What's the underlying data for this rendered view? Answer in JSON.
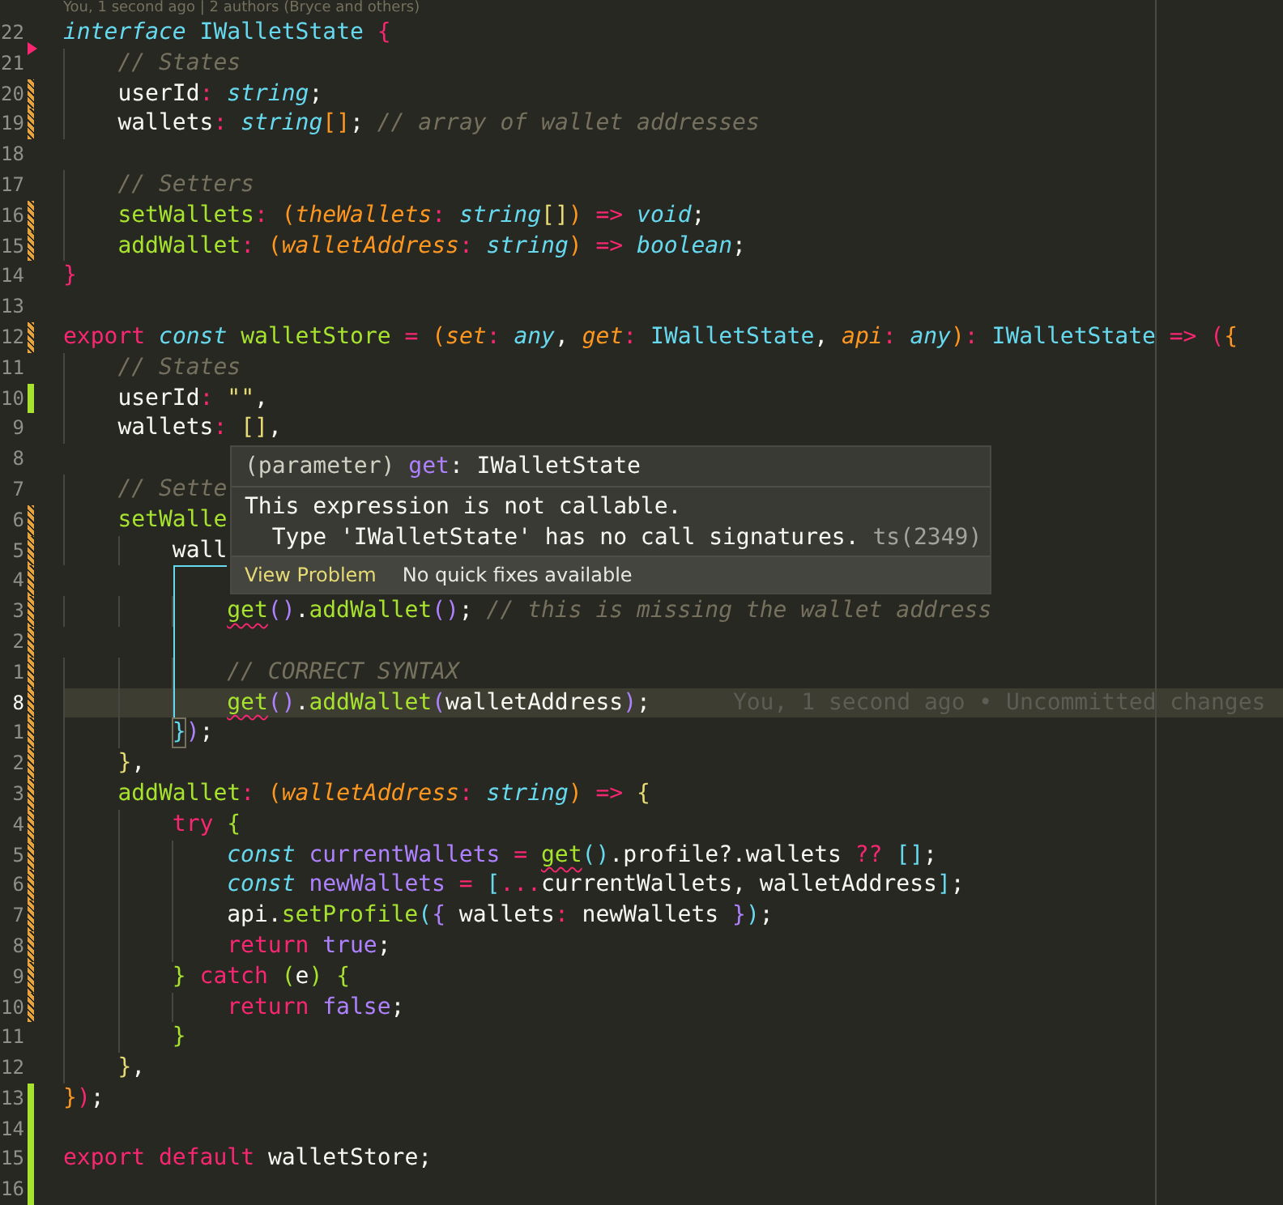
{
  "codelens": "You, 1 second ago | 2 authors (Bryce and others)",
  "lines": [
    {
      "number": "22",
      "kind": "unchanged",
      "current": false,
      "tokens": [
        {
          "t": "interface ",
          "kind": "st"
        },
        {
          "t": "IWalletState ",
          "kind": "ty"
        },
        {
          "t": "{",
          "kind": "bp"
        }
      ]
    },
    {
      "number": "21",
      "kind": "deleted",
      "current": false,
      "tokens": [
        {
          "t": "    // States",
          "kind": "cm"
        }
      ]
    },
    {
      "number": "20",
      "kind": "modified",
      "current": false,
      "tokens": [
        {
          "t": "    userId",
          "kind": "tx"
        },
        {
          "t": ": ",
          "kind": "pu"
        },
        {
          "t": "string",
          "kind": "ti"
        },
        {
          "t": ";",
          "kind": "tx"
        }
      ]
    },
    {
      "number": "19",
      "kind": "modified",
      "current": false,
      "tokens": [
        {
          "t": "    wallets",
          "kind": "tx"
        },
        {
          "t": ": ",
          "kind": "pu"
        },
        {
          "t": "string",
          "kind": "ti"
        },
        {
          "t": "[]",
          "kind": "bo"
        },
        {
          "t": "; ",
          "kind": "tx"
        },
        {
          "t": "// array of wallet addresses",
          "kind": "cm"
        }
      ]
    },
    {
      "number": "18",
      "kind": "unchanged",
      "current": false
    },
    {
      "number": "17",
      "kind": "unchanged",
      "current": false,
      "tokens": [
        {
          "t": "    // Setters",
          "kind": "cm"
        }
      ]
    },
    {
      "number": "16",
      "kind": "modified",
      "current": false,
      "tokens": [
        {
          "t": "    setWallets",
          "kind": "fn"
        },
        {
          "t": ": ",
          "kind": "pu"
        },
        {
          "t": "(",
          "kind": "bo"
        },
        {
          "t": "theWallets",
          "kind": "pa"
        },
        {
          "t": ": ",
          "kind": "pu"
        },
        {
          "t": "string",
          "kind": "ti"
        },
        {
          "t": "[]",
          "kind": "by"
        },
        {
          "t": ") ",
          "kind": "bo"
        },
        {
          "t": "=> ",
          "kind": "op"
        },
        {
          "t": "void",
          "kind": "ti"
        },
        {
          "t": ";",
          "kind": "tx"
        }
      ]
    },
    {
      "number": "15",
      "kind": "modified",
      "current": false,
      "tokens": [
        {
          "t": "    addWallet",
          "kind": "fn"
        },
        {
          "t": ": ",
          "kind": "pu"
        },
        {
          "t": "(",
          "kind": "bo"
        },
        {
          "t": "walletAddress",
          "kind": "pa"
        },
        {
          "t": ": ",
          "kind": "pu"
        },
        {
          "t": "string",
          "kind": "ti"
        },
        {
          "t": ") ",
          "kind": "bo"
        },
        {
          "t": "=> ",
          "kind": "op"
        },
        {
          "t": "boolean",
          "kind": "ti"
        },
        {
          "t": ";",
          "kind": "tx"
        }
      ]
    },
    {
      "number": "14",
      "kind": "unchanged",
      "current": false,
      "tokens": [
        {
          "t": "}",
          "kind": "bp"
        }
      ]
    },
    {
      "number": "13",
      "kind": "unchanged",
      "current": false
    },
    {
      "number": "12",
      "kind": "modified",
      "current": false,
      "tokens": [
        {
          "t": "export ",
          "kind": "kw"
        },
        {
          "t": "const ",
          "kind": "st"
        },
        {
          "t": "walletStore ",
          "kind": "fn"
        },
        {
          "t": "= ",
          "kind": "op"
        },
        {
          "t": "(",
          "kind": "bo"
        },
        {
          "t": "set",
          "kind": "pa"
        },
        {
          "t": ": ",
          "kind": "pu"
        },
        {
          "t": "any",
          "kind": "ti"
        },
        {
          "t": ", ",
          "kind": "tx"
        },
        {
          "t": "get",
          "kind": "pa"
        },
        {
          "t": ": ",
          "kind": "pu"
        },
        {
          "t": "IWalletState",
          "kind": "ty"
        },
        {
          "t": ", ",
          "kind": "tx"
        },
        {
          "t": "api",
          "kind": "pa"
        },
        {
          "t": ": ",
          "kind": "pu"
        },
        {
          "t": "any",
          "kind": "ti"
        },
        {
          "t": ")",
          "kind": "bo"
        },
        {
          "t": ": ",
          "kind": "pu"
        },
        {
          "t": "IWalletState ",
          "kind": "ty"
        },
        {
          "t": "=> ",
          "kind": "op"
        },
        {
          "t": "(",
          "kind": "bp"
        },
        {
          "t": "{",
          "kind": "bo"
        }
      ]
    },
    {
      "number": "11",
      "kind": "unchanged",
      "current": false,
      "tokens": [
        {
          "t": "    // States",
          "kind": "cm"
        }
      ]
    },
    {
      "number": "10",
      "kind": "added",
      "current": false,
      "tokens": [
        {
          "t": "    userId",
          "kind": "tx"
        },
        {
          "t": ": ",
          "kind": "pu"
        },
        {
          "t": "\"\"",
          "kind": "s"
        },
        {
          "t": ",",
          "kind": "tx"
        }
      ]
    },
    {
      "number": "9",
      "kind": "unchanged",
      "current": false,
      "tokens": [
        {
          "t": "    wallets",
          "kind": "tx"
        },
        {
          "t": ": ",
          "kind": "pu"
        },
        {
          "t": "[]",
          "kind": "by"
        },
        {
          "t": ",",
          "kind": "tx"
        }
      ]
    },
    {
      "number": "8",
      "kind": "unchanged",
      "current": false
    },
    {
      "number": "7",
      "kind": "unchanged",
      "current": false,
      "tokens": [
        {
          "t": "    // Sette",
          "kind": "cm"
        }
      ]
    },
    {
      "number": "6",
      "kind": "modified",
      "current": false,
      "tokens": [
        {
          "t": "    setWalle",
          "kind": "fn"
        }
      ]
    },
    {
      "number": "5",
      "kind": "modified",
      "current": false,
      "tokens": [
        {
          "t": "        wall",
          "kind": "tx"
        }
      ]
    },
    {
      "number": "4",
      "kind": "modified",
      "current": false
    },
    {
      "number": "3",
      "kind": "modified",
      "current": false,
      "tokens": [
        {
          "t": "            get",
          "kind": "err"
        },
        {
          "t": "()",
          "kind": "bv"
        },
        {
          "t": ".",
          "kind": "tx"
        },
        {
          "t": "addWallet",
          "kind": "fn"
        },
        {
          "t": "()",
          "kind": "bv"
        },
        {
          "t": "; ",
          "kind": "tx"
        },
        {
          "t": "// this is missing the wallet address",
          "kind": "cm"
        }
      ]
    },
    {
      "number": "2",
      "kind": "modified",
      "current": false
    },
    {
      "number": "1",
      "kind": "modified",
      "current": false,
      "tokens": [
        {
          "t": "            // CORRECT SYNTAX",
          "kind": "cm"
        }
      ]
    },
    {
      "number": "8",
      "kind": "modified",
      "current": true,
      "blame": "You, 1 second ago • Uncommitted changes",
      "tokens": [
        {
          "t": "            get",
          "kind": "err"
        },
        {
          "t": "()",
          "kind": "bv"
        },
        {
          "t": ".",
          "kind": "tx"
        },
        {
          "t": "addWallet",
          "kind": "fn"
        },
        {
          "t": "(",
          "kind": "bv"
        },
        {
          "t": "walletAddress",
          "kind": "tx"
        },
        {
          "t": ")",
          "kind": "bv"
        },
        {
          "t": ";",
          "kind": "tx"
        }
      ]
    },
    {
      "number": "1",
      "kind": "modified",
      "current": false,
      "tokens": [
        {
          "t": "        }",
          "kind": "bm"
        },
        {
          "t": ")",
          "kind": "bv"
        },
        {
          "t": ";",
          "kind": "tx"
        }
      ]
    },
    {
      "number": "2",
      "kind": "modified",
      "current": false,
      "tokens": [
        {
          "t": "    }",
          "kind": "by"
        },
        {
          "t": ",",
          "kind": "tx"
        }
      ]
    },
    {
      "number": "3",
      "kind": "modified",
      "current": false,
      "tokens": [
        {
          "t": "    addWallet",
          "kind": "fn"
        },
        {
          "t": ": ",
          "kind": "pu"
        },
        {
          "t": "(",
          "kind": "bo"
        },
        {
          "t": "walletAddress",
          "kind": "pa"
        },
        {
          "t": ": ",
          "kind": "pu"
        },
        {
          "t": "string",
          "kind": "ti"
        },
        {
          "t": ") ",
          "kind": "bo"
        },
        {
          "t": "=> ",
          "kind": "op"
        },
        {
          "t": "{",
          "kind": "by"
        }
      ]
    },
    {
      "number": "4",
      "kind": "modified",
      "current": false,
      "tokens": [
        {
          "t": "        try ",
          "kind": "kw"
        },
        {
          "t": "{",
          "kind": "bg"
        }
      ]
    },
    {
      "number": "5",
      "kind": "modified",
      "current": false,
      "tokens": [
        {
          "t": "            const ",
          "kind": "st"
        },
        {
          "t": "currentWallets ",
          "kind": "cn"
        },
        {
          "t": "= ",
          "kind": "op"
        },
        {
          "t": "get",
          "kind": "err"
        },
        {
          "t": "()",
          "kind": "bc"
        },
        {
          "t": ".profile?.wallets ",
          "kind": "tx"
        },
        {
          "t": "?? ",
          "kind": "op"
        },
        {
          "t": "[]",
          "kind": "bc"
        },
        {
          "t": ";",
          "kind": "tx"
        }
      ]
    },
    {
      "number": "6",
      "kind": "modified",
      "current": false,
      "tokens": [
        {
          "t": "            const ",
          "kind": "st"
        },
        {
          "t": "newWallets ",
          "kind": "cn"
        },
        {
          "t": "= ",
          "kind": "op"
        },
        {
          "t": "[",
          "kind": "bc"
        },
        {
          "t": "...",
          "kind": "op"
        },
        {
          "t": "currentWallets, walletAddress",
          "kind": "tx"
        },
        {
          "t": "]",
          "kind": "bc"
        },
        {
          "t": ";",
          "kind": "tx"
        }
      ]
    },
    {
      "number": "7",
      "kind": "modified",
      "current": false,
      "tokens": [
        {
          "t": "            api.",
          "kind": "tx"
        },
        {
          "t": "setProfile",
          "kind": "fn"
        },
        {
          "t": "(",
          "kind": "bc"
        },
        {
          "t": "{",
          "kind": "bv"
        },
        {
          "t": " wallets",
          "kind": "tx"
        },
        {
          "t": ":",
          "kind": "pu"
        },
        {
          "t": " newWallets ",
          "kind": "tx"
        },
        {
          "t": "}",
          "kind": "bv"
        },
        {
          "t": ")",
          "kind": "bc"
        },
        {
          "t": ";",
          "kind": "tx"
        }
      ]
    },
    {
      "number": "8",
      "kind": "modified",
      "current": false,
      "tokens": [
        {
          "t": "            return ",
          "kind": "kw"
        },
        {
          "t": "true",
          "kind": "cn"
        },
        {
          "t": ";",
          "kind": "tx"
        }
      ]
    },
    {
      "number": "9",
      "kind": "modified",
      "current": false,
      "tokens": [
        {
          "t": "        } ",
          "kind": "bg"
        },
        {
          "t": "catch ",
          "kind": "kw"
        },
        {
          "t": "(",
          "kind": "bg"
        },
        {
          "t": "e",
          "kind": "tx"
        },
        {
          "t": ") {",
          "kind": "bg"
        }
      ]
    },
    {
      "number": "10",
      "kind": "modified",
      "current": false,
      "tokens": [
        {
          "t": "            return ",
          "kind": "kw"
        },
        {
          "t": "false",
          "kind": "cn"
        },
        {
          "t": ";",
          "kind": "tx"
        }
      ]
    },
    {
      "number": "11",
      "kind": "unchanged",
      "current": false,
      "tokens": [
        {
          "t": "        }",
          "kind": "bg"
        }
      ]
    },
    {
      "number": "12",
      "kind": "unchanged",
      "current": false,
      "tokens": [
        {
          "t": "    }",
          "kind": "by"
        },
        {
          "t": ",",
          "kind": "tx"
        }
      ]
    },
    {
      "number": "13",
      "kind": "added",
      "current": false,
      "tokens": [
        {
          "t": "}",
          "kind": "bo"
        },
        {
          "t": ")",
          "kind": "bp"
        },
        {
          "t": ";",
          "kind": "tx"
        }
      ]
    },
    {
      "number": "14",
      "kind": "added",
      "current": false
    },
    {
      "number": "15",
      "kind": "added",
      "current": false,
      "tokens": [
        {
          "t": "export default ",
          "kind": "kw"
        },
        {
          "t": "walletStore;",
          "kind": "tx"
        }
      ]
    },
    {
      "number": "16",
      "kind": "added",
      "current": false
    }
  ],
  "tooltip": {
    "signature": [
      {
        "t": "(parameter) ",
        "kind": "dim"
      },
      {
        "t": "get",
        "kind": "cn"
      },
      {
        "t": ": IWalletState",
        "kind": "tx"
      }
    ],
    "message": [
      "This expression is not callable.",
      "  Type 'IWalletState' has no call signatures."
    ],
    "code": "ts(2349)",
    "actions": [
      {
        "label": "View Problem",
        "kind": "link"
      },
      {
        "label": "No quick fixes available",
        "kind": "note"
      }
    ]
  }
}
